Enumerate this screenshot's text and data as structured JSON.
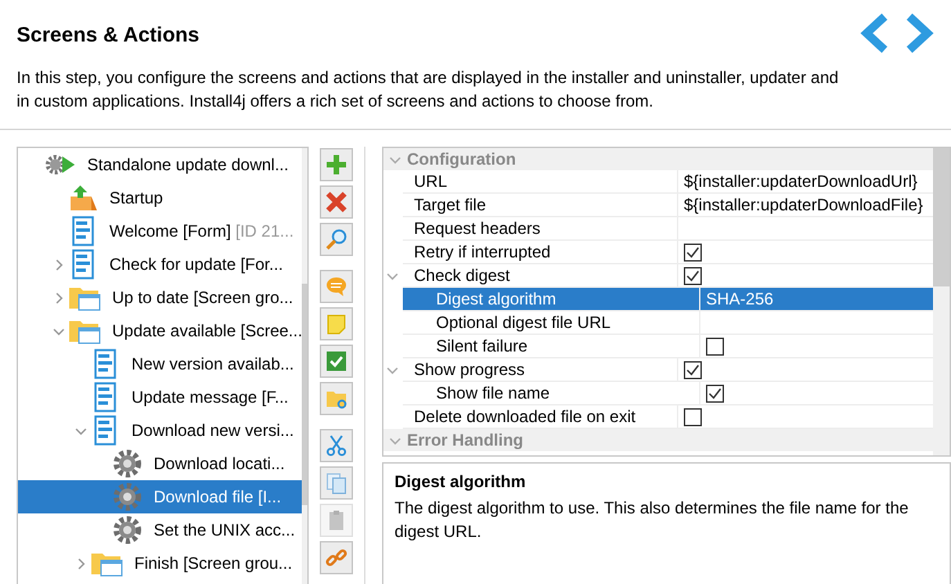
{
  "header": {
    "title": "Screens & Actions",
    "description": "In this step, you configure the screens and actions that are displayed in the installer and uninstaller, updater and in custom applications. Install4j offers a rich set of screens and actions to choose from."
  },
  "tree": [
    {
      "kind": "launcher",
      "label": "Standalone update downl...",
      "selected": false,
      "children": [
        {
          "kind": "startup",
          "label": "Startup",
          "selected": false
        },
        {
          "kind": "form",
          "label": "Welcome [Form]",
          "suffix": "[ID 21...",
          "selected": false
        },
        {
          "kind": "form",
          "label": "Check for update [For...",
          "expanded": false,
          "selected": false
        },
        {
          "kind": "group",
          "label": "Up to date [Screen gro...",
          "expanded": false,
          "selected": false
        },
        {
          "kind": "group",
          "label": "Update available [Scree...",
          "expanded": true,
          "selected": false,
          "children": [
            {
              "kind": "form",
              "label": "New version availab...",
              "selected": false
            },
            {
              "kind": "form",
              "label": "Update message [F...",
              "selected": false
            },
            {
              "kind": "form",
              "label": "Download new versi...",
              "expanded": true,
              "selected": false,
              "children": [
                {
                  "kind": "action",
                  "label": "Download locati...",
                  "selected": false
                },
                {
                  "kind": "action",
                  "label": "Download file [I...",
                  "selected": true
                },
                {
                  "kind": "action",
                  "label": "Set the UNIX acc...",
                  "selected": false
                }
              ]
            },
            {
              "kind": "group",
              "label": "Finish [Screen grou...",
              "expanded": false,
              "selected": false
            }
          ]
        }
      ]
    }
  ],
  "toolbar": [
    [
      {
        "kind": "add",
        "disabled": false
      },
      {
        "kind": "delete",
        "disabled": false
      },
      {
        "kind": "search",
        "disabled": false
      }
    ],
    [
      {
        "kind": "comment",
        "disabled": false
      },
      {
        "kind": "note",
        "disabled": false
      },
      {
        "kind": "check",
        "disabled": false
      },
      {
        "kind": "folder",
        "disabled": false
      }
    ],
    [
      {
        "kind": "cut",
        "disabled": false
      },
      {
        "kind": "copy",
        "disabled": false
      },
      {
        "kind": "paste",
        "disabled": true
      },
      {
        "kind": "link",
        "disabled": false
      }
    ]
  ],
  "properties": [
    {
      "kind": "group",
      "name": "Configuration",
      "expanded": true,
      "selected": false,
      "children": [
        {
          "kind": "text",
          "name": "URL",
          "value": "${installer:updaterDownloadUrl}",
          "selected": false
        },
        {
          "kind": "text",
          "name": "Target file",
          "value": "${installer:updaterDownloadFile}",
          "selected": false
        },
        {
          "kind": "text",
          "name": "Request headers",
          "selected": false
        },
        {
          "kind": "checkbox",
          "name": "Retry if interrupted",
          "checked": true,
          "selected": false
        },
        {
          "kind": "checkbox",
          "name": "Check digest",
          "checked": true,
          "expanded": true,
          "selected": false,
          "children": [
            {
              "kind": "text",
              "name": "Digest algorithm",
              "value": "SHA-256",
              "selected": true
            },
            {
              "kind": "text",
              "name": "Optional digest file URL",
              "selected": false
            },
            {
              "kind": "checkbox",
              "name": "Silent failure",
              "checked": false,
              "selected": false
            }
          ]
        },
        {
          "kind": "checkbox",
          "name": "Show progress",
          "checked": true,
          "expanded": true,
          "selected": false,
          "children": [
            {
              "kind": "checkbox",
              "name": "Show file name",
              "checked": true,
              "selected": false
            }
          ]
        },
        {
          "kind": "checkbox",
          "name": "Delete downloaded file on exit",
          "checked": false,
          "selected": false
        }
      ]
    },
    {
      "kind": "group",
      "name": "Error Handling",
      "expanded": true,
      "selected": false
    }
  ],
  "help": {
    "title": "Digest algorithm",
    "text": "The digest algorithm to use. This also determines the file name for the digest URL."
  }
}
